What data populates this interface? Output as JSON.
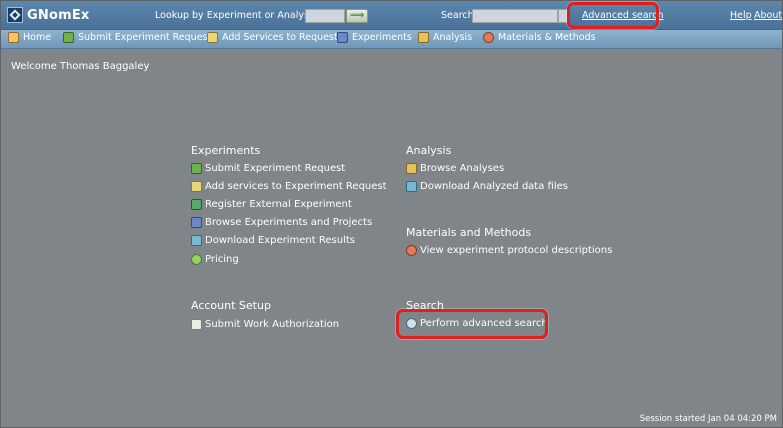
{
  "app": {
    "name": "GNomEx"
  },
  "header": {
    "lookup_label": "Lookup by Experiment or Analysis #",
    "lookup_value": "",
    "go_glyph": "⟹",
    "search_label": "Search",
    "search_value": "",
    "advanced_search": "Advanced search",
    "help": "Help",
    "about": "About"
  },
  "menu": [
    {
      "label": "Home",
      "icon": "home-icon"
    },
    {
      "label": "Submit Experiment Request",
      "icon": "submit-request-icon"
    },
    {
      "label": "Add Services to Request",
      "icon": "add-services-icon"
    },
    {
      "label": "Experiments",
      "icon": "flask-icon"
    },
    {
      "label": "Analysis",
      "icon": "analysis-icon"
    },
    {
      "label": "Materials & Methods",
      "icon": "materials-icon"
    }
  ],
  "welcome": "Welcome Thomas Baggaley",
  "sections": {
    "experiments": {
      "title": "Experiments",
      "links": [
        "Submit Experiment Request",
        "Add services to Experiment Request",
        "Register External Experiment",
        "Browse Experiments and Projects",
        "Download Experiment Results",
        "Pricing"
      ]
    },
    "analysis": {
      "title": "Analysis",
      "links": [
        "Browse Analyses",
        "Download Analyzed data files"
      ]
    },
    "materials": {
      "title": "Materials and Methods",
      "links": [
        "View experiment protocol descriptions"
      ]
    },
    "account": {
      "title": "Account Setup",
      "links": [
        "Submit Work Authorization"
      ]
    },
    "search": {
      "title": "Search",
      "links": [
        "Perform advanced search"
      ]
    }
  },
  "session": "Session started Jan 04 04:20 PM",
  "colors": {
    "header": "#4f779e",
    "menubar": "#7ea5c3",
    "background": "#7f8588",
    "highlight": "#e02020"
  }
}
